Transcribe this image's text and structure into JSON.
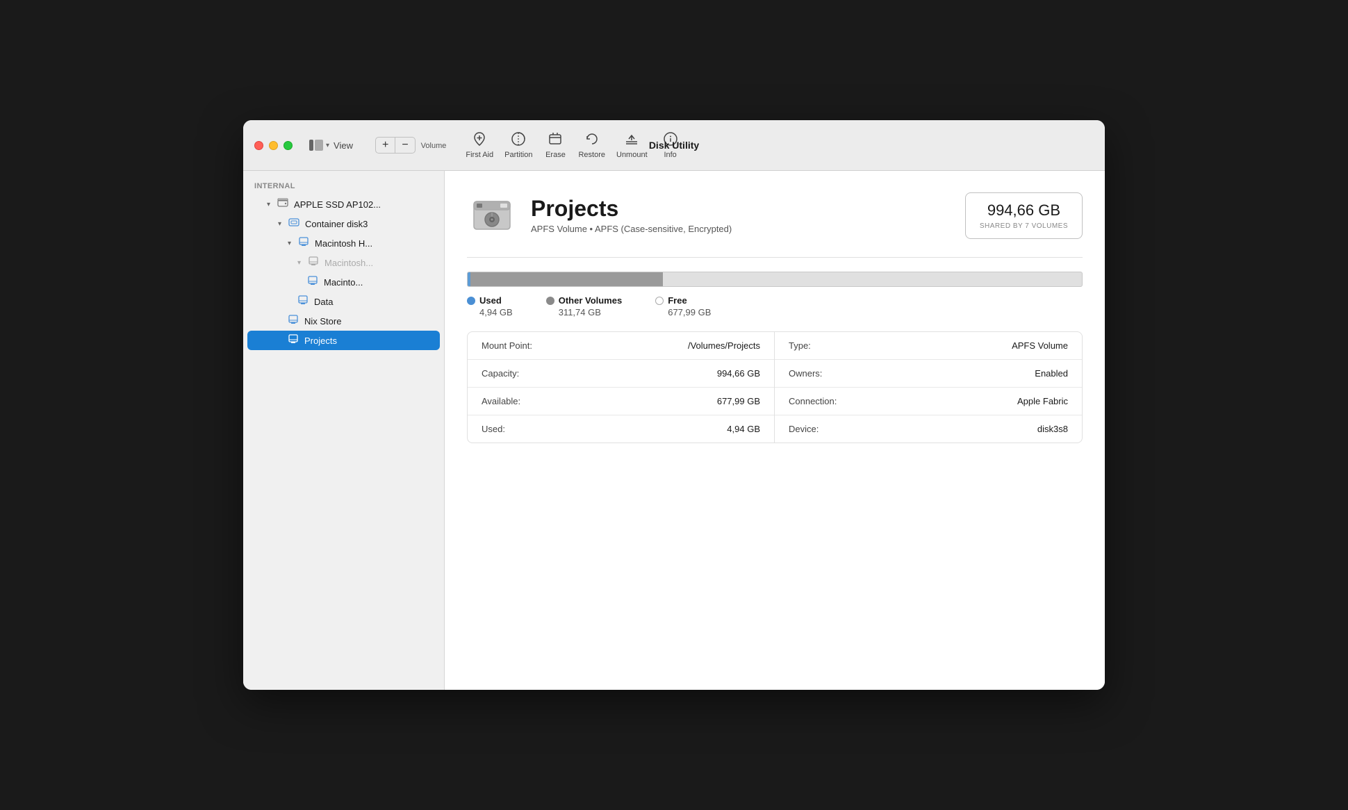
{
  "window": {
    "title": "Disk Utility"
  },
  "titlebar": {
    "view_label": "View",
    "view_chevron": "⌄"
  },
  "toolbar": {
    "volume_add": "+",
    "volume_remove": "−",
    "volume_label": "Volume",
    "firstaid_label": "First Aid",
    "partition_label": "Partition",
    "erase_label": "Erase",
    "restore_label": "Restore",
    "unmount_label": "Unmount",
    "info_label": "Info"
  },
  "sidebar": {
    "section_internal": "Internal",
    "items": [
      {
        "id": "apple-ssd",
        "label": "APPLE SSD AP102...",
        "indent": 1,
        "type": "drive",
        "chevron": "▾"
      },
      {
        "id": "container-disk3",
        "label": "Container disk3",
        "indent": 2,
        "type": "container",
        "chevron": "▾"
      },
      {
        "id": "macintosh-h",
        "label": "Macintosh H...",
        "indent": 3,
        "type": "volume",
        "chevron": "▾"
      },
      {
        "id": "macintosh-snap",
        "label": "Macintosh...",
        "indent": 4,
        "type": "volume-dim",
        "chevron": "▾"
      },
      {
        "id": "macinto",
        "label": "Macinto...",
        "indent": 5,
        "type": "volume"
      },
      {
        "id": "data",
        "label": "Data",
        "indent": 4,
        "type": "volume"
      },
      {
        "id": "nix-store",
        "label": "Nix Store",
        "indent": 3,
        "type": "volume"
      },
      {
        "id": "projects",
        "label": "Projects",
        "indent": 3,
        "type": "volume",
        "active": true
      }
    ]
  },
  "detail": {
    "volume_name": "Projects",
    "volume_subtitle": "APFS Volume • APFS (Case-sensitive, Encrypted)",
    "volume_size": "994,66 GB",
    "volume_size_label": "SHARED BY 7 VOLUMES",
    "storage": {
      "used_pct": 0.5,
      "other_pct": 31.3,
      "free_pct": 68.2,
      "used_label": "Used",
      "used_value": "4,94 GB",
      "other_label": "Other Volumes",
      "other_value": "311,74 GB",
      "free_label": "Free",
      "free_value": "677,99 GB"
    },
    "info_rows_left": [
      {
        "key": "Mount Point:",
        "value": "/Volumes/Projects"
      },
      {
        "key": "Capacity:",
        "value": "994,66 GB"
      },
      {
        "key": "Available:",
        "value": "677,99 GB"
      },
      {
        "key": "Used:",
        "value": "4,94 GB"
      }
    ],
    "info_rows_right": [
      {
        "key": "Type:",
        "value": "APFS Volume"
      },
      {
        "key": "Owners:",
        "value": "Enabled"
      },
      {
        "key": "Connection:",
        "value": "Apple Fabric"
      },
      {
        "key": "Device:",
        "value": "disk3s8"
      }
    ]
  }
}
